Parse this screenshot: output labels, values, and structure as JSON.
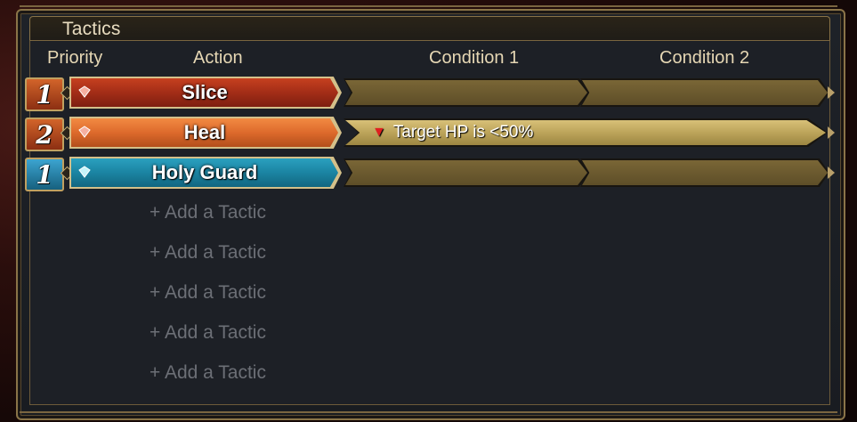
{
  "window": {
    "title": "Tactics"
  },
  "columns": {
    "priority": "Priority",
    "action": "Action",
    "condition1": "Condition 1",
    "condition2": "Condition 2"
  },
  "tactics": [
    {
      "priority": "1",
      "action": "Slice",
      "condition1": "",
      "condition2": "",
      "color": "#a8301a",
      "prio_color": "#b54a1e",
      "gem_color": "#f07070"
    },
    {
      "priority": "2",
      "action": "Heal",
      "condition1": "Target HP is <50%",
      "condition2": "",
      "color": "#d9662a",
      "prio_color": "#c45a22",
      "gem_color": "#f07070"
    },
    {
      "priority": "1",
      "action": "Holy Guard",
      "condition1": "",
      "condition2": "",
      "color": "#1f8aa8",
      "prio_color": "#2a86b0",
      "gem_color": "#9be6f0"
    }
  ],
  "empty_slots": [
    {
      "label": "+ Add a Tactic"
    },
    {
      "label": "+ Add a Tactic"
    },
    {
      "label": "+ Add a Tactic"
    },
    {
      "label": "+ Add a Tactic"
    },
    {
      "label": "+ Add a Tactic"
    }
  ],
  "colors": {
    "frame_gold": "#8a7448",
    "condition_empty": "#6e5c32",
    "condition_set": "#c8b068",
    "add_tactic_text": "#6c6f76"
  }
}
